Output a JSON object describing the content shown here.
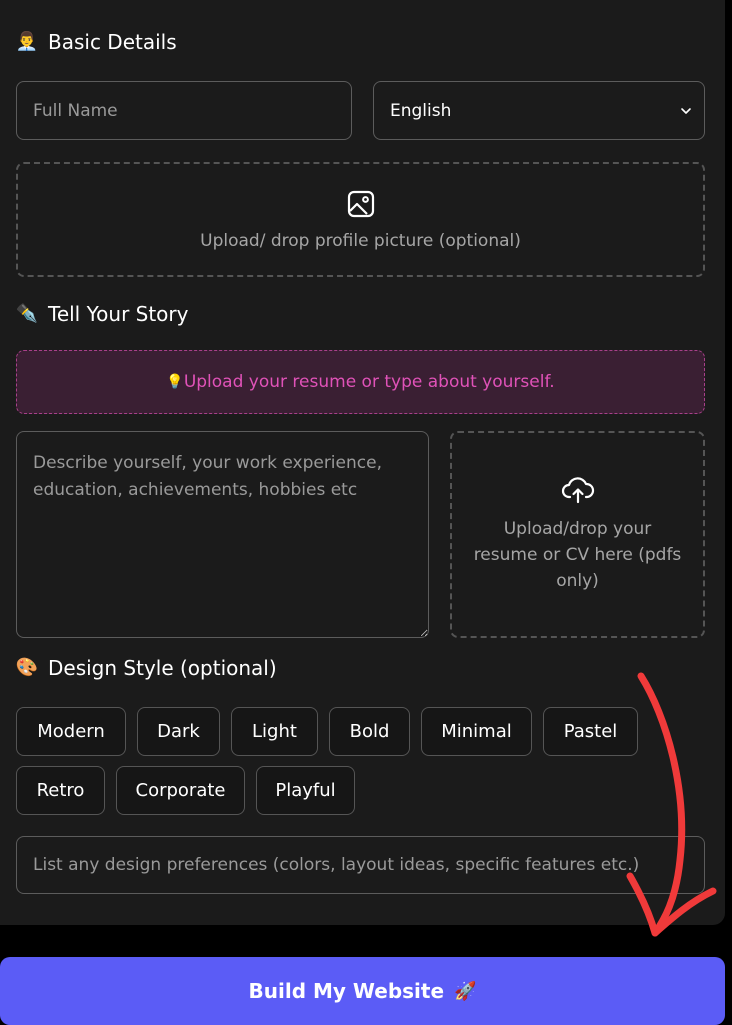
{
  "basic_details": {
    "title": "Basic Details",
    "emoji": "👨‍💼",
    "full_name_placeholder": "Full Name",
    "full_name_value": "",
    "language_selected": "English",
    "profile_upload_text": "Upload/ drop profile picture (optional)"
  },
  "story": {
    "title": "Tell Your Story",
    "emoji": "✒️",
    "hint_emoji": "💡",
    "hint_text": "Upload your resume or type about yourself.",
    "description_placeholder": "Describe yourself, your work experience, education, achievements, hobbies etc",
    "resume_upload_text": "Upload/drop your resume or CV here (pdfs only)"
  },
  "design": {
    "title": "Design Style (optional)",
    "emoji": "🎨",
    "styles": [
      "Modern",
      "Dark",
      "Light",
      "Bold",
      "Minimal",
      "Pastel",
      "Retro",
      "Corporate",
      "Playful"
    ],
    "preferences_placeholder": "List any design preferences (colors, layout ideas, specific features etc.)"
  },
  "build_button": {
    "label": "Build My Website",
    "emoji": "🚀"
  },
  "colors": {
    "panel_bg": "#1b1b1b",
    "accent": "#5b5cf6",
    "hint_text": "#e052b8",
    "annotation_arrow": "#f03a3a"
  },
  "icons": {
    "profile_upload": "image-icon",
    "resume_upload": "cloud-upload-icon",
    "select": "chevron-down-icon"
  }
}
